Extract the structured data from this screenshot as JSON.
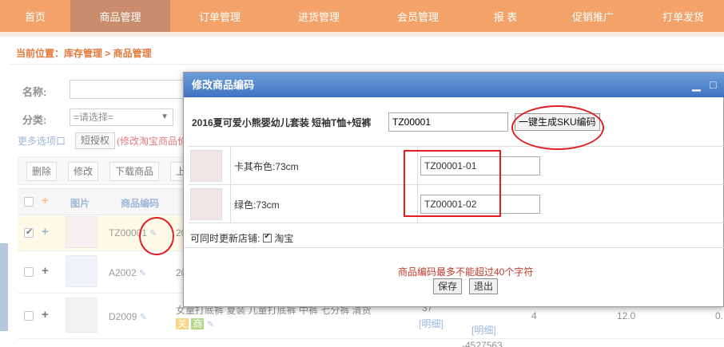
{
  "nav": {
    "items": [
      {
        "label": "首页",
        "width": 88
      },
      {
        "label": "商品管理",
        "width": 125,
        "active": true
      },
      {
        "label": "订单管理",
        "width": 124
      },
      {
        "label": "进货管理",
        "width": 124
      },
      {
        "label": "会员管理",
        "width": 124
      },
      {
        "label": "报    表",
        "width": 95
      },
      {
        "label": "促销推广",
        "width": 124
      },
      {
        "label": "打单发货",
        "width": 102
      }
    ]
  },
  "breadcrumb": "当前位置：库存管理 > 商品管理",
  "filters": {
    "name_label": "名称:",
    "category_label": "分类:",
    "category_value": "=请选择=",
    "more_options": "更多选项口",
    "auth_button": "短授权",
    "auth_note": "(修改淘宝商品价"
  },
  "toolbar": {
    "delete": "删除",
    "edit": "修改",
    "offline": "下载商品",
    "more": "上"
  },
  "table": {
    "headers": {
      "image": "图片",
      "code": "商品编码"
    },
    "rows": [
      {
        "code": "TZ00001",
        "extra": "20"
      },
      {
        "code": "A2002",
        "extra": "20"
      },
      {
        "code": "D2009",
        "title": "女童打底裤 夏装 儿童打底裤 中裤 七分裤 清货",
        "tag1": "关",
        "tag2": "商",
        "stock": "37",
        "detail": "[明细]",
        "detail2": "[明细]",
        "num": "4",
        "price": "12.0",
        "last": "0."
      }
    ],
    "partial_bottom": "-4527563"
  },
  "modal": {
    "title": "修改商品编码",
    "product_title": "2016夏可爱小熊婴幼儿套装 短袖T恤+短裤",
    "main_sku": "TZ00001",
    "generate_button": "一键生成SKU编码",
    "skus": [
      {
        "color": "卡其布色:73cm",
        "code": "TZ00001-01"
      },
      {
        "color": "绿色:73cm",
        "code": "TZ00001-02"
      }
    ],
    "sync_label": "可同时更新店铺:",
    "sync_store": "淘宝",
    "warning": "商品编码最多不能超过40个字符",
    "save": "保存",
    "exit": "退出",
    "minimize": "▁",
    "maximize": "□"
  },
  "colors": {
    "nav_bg": "#f3a36a",
    "nav_active": "#c98c6c",
    "modal_title_bg": "#4a7fc8",
    "annotation": "#e02020",
    "warning": "#c0392b"
  }
}
